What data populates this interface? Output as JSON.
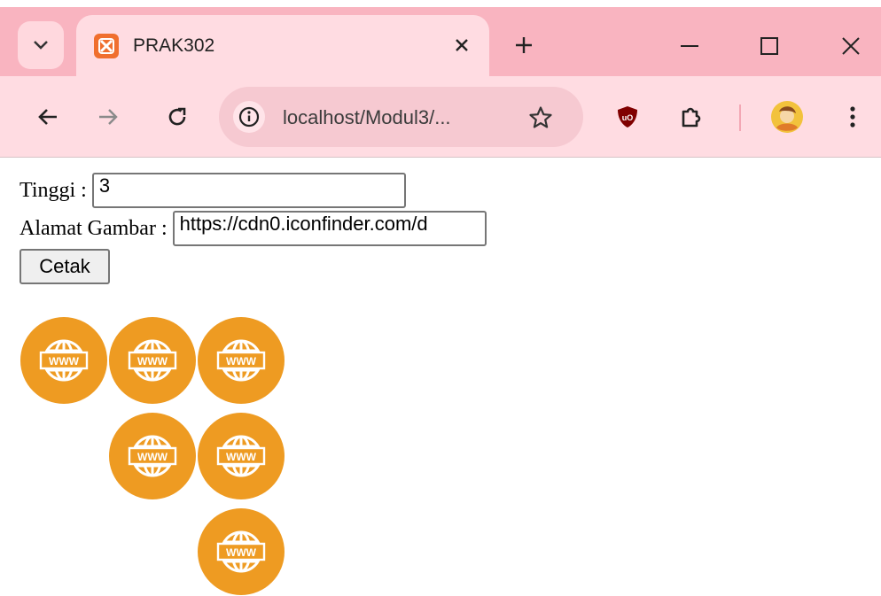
{
  "browser": {
    "tab_title": "PRAK302",
    "address": "localhost/Modul3/...",
    "icons": [
      "tab-search-icon",
      "xampp-favicon-icon",
      "close-icon",
      "plus-icon",
      "minimize-icon",
      "maximize-icon",
      "close-window-icon",
      "back-arrow-icon",
      "forward-arrow-icon",
      "reload-icon",
      "info-icon",
      "star-icon",
      "ublock-icon",
      "extensions-icon",
      "profile-avatar",
      "more-menu-icon"
    ]
  },
  "form": {
    "tinggi_label": "Tinggi :",
    "tinggi_value": "3",
    "alamat_label": "Alamat Gambar :",
    "alamat_value": "https://cdn0.iconfinder.com/d",
    "submit_label": "Cetak"
  },
  "output": {
    "rows": [
      3,
      2,
      1
    ],
    "icon": "www-globe-icon",
    "icon_color": "#ee9b22",
    "icon_text": "WWW"
  },
  "colors": {
    "tabbar": "#f9b4c0",
    "toolbar": "#ffdce2"
  }
}
